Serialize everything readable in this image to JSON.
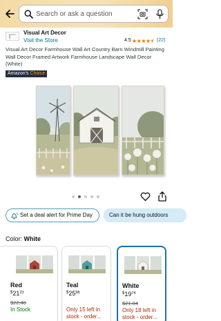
{
  "search": {
    "placeholder": "Search or ask a question"
  },
  "brand": {
    "name": "Visual Art Decor",
    "store_link": "Visit the Store",
    "rating": "4.5",
    "stars": "★★★★⯨",
    "rating_count": "(22)"
  },
  "product": {
    "title": "Visual Art Decor Farmhouse Wall Art Country Barn Windmill Painting Wall Decor Framed Artwork Farmhouse Landscape Wall Decor (White)",
    "badge_prefix": "Amazon's",
    "badge_suffix": "Choice"
  },
  "gallery": {
    "image_count": 5,
    "active_index": 1
  },
  "chips": {
    "deal_alert": "Set a deal alert for Prime Day",
    "question": "Can it be hung outdoors"
  },
  "color": {
    "label": "Color:",
    "selected": "White"
  },
  "swatches": [
    {
      "name": "Red",
      "currency": "$",
      "whole": "21",
      "fraction": "23",
      "list_price": "$22.48",
      "stock_line1": "In Stock",
      "stock_line2": ""
    },
    {
      "name": "Teal",
      "currency": "$",
      "whole": "25",
      "fraction": "98",
      "list_price": "",
      "stock_line1": "Only 15 left in",
      "stock_line2": "stock - order..."
    },
    {
      "name": "White",
      "currency": "$",
      "whole": "19",
      "fraction": "74",
      "list_price": "$21.04",
      "stock_line1": "Only 18 left in",
      "stock_line2": "stock - order..."
    }
  ],
  "icons": {
    "back": "arrow-left-icon",
    "search": "search-icon",
    "camera": "camera-scan-icon",
    "mic": "microphone-icon",
    "heart": "heart-icon",
    "share": "share-icon",
    "bell": "bell-icon"
  },
  "colors": {
    "header_gradient_start": "#f4dba4",
    "link": "#007185",
    "star": "#e77600",
    "in_stock": "#007600",
    "low_stock": "#b12704",
    "selected_border": "#1e6fa8",
    "badge_bg": "#232f3e"
  }
}
